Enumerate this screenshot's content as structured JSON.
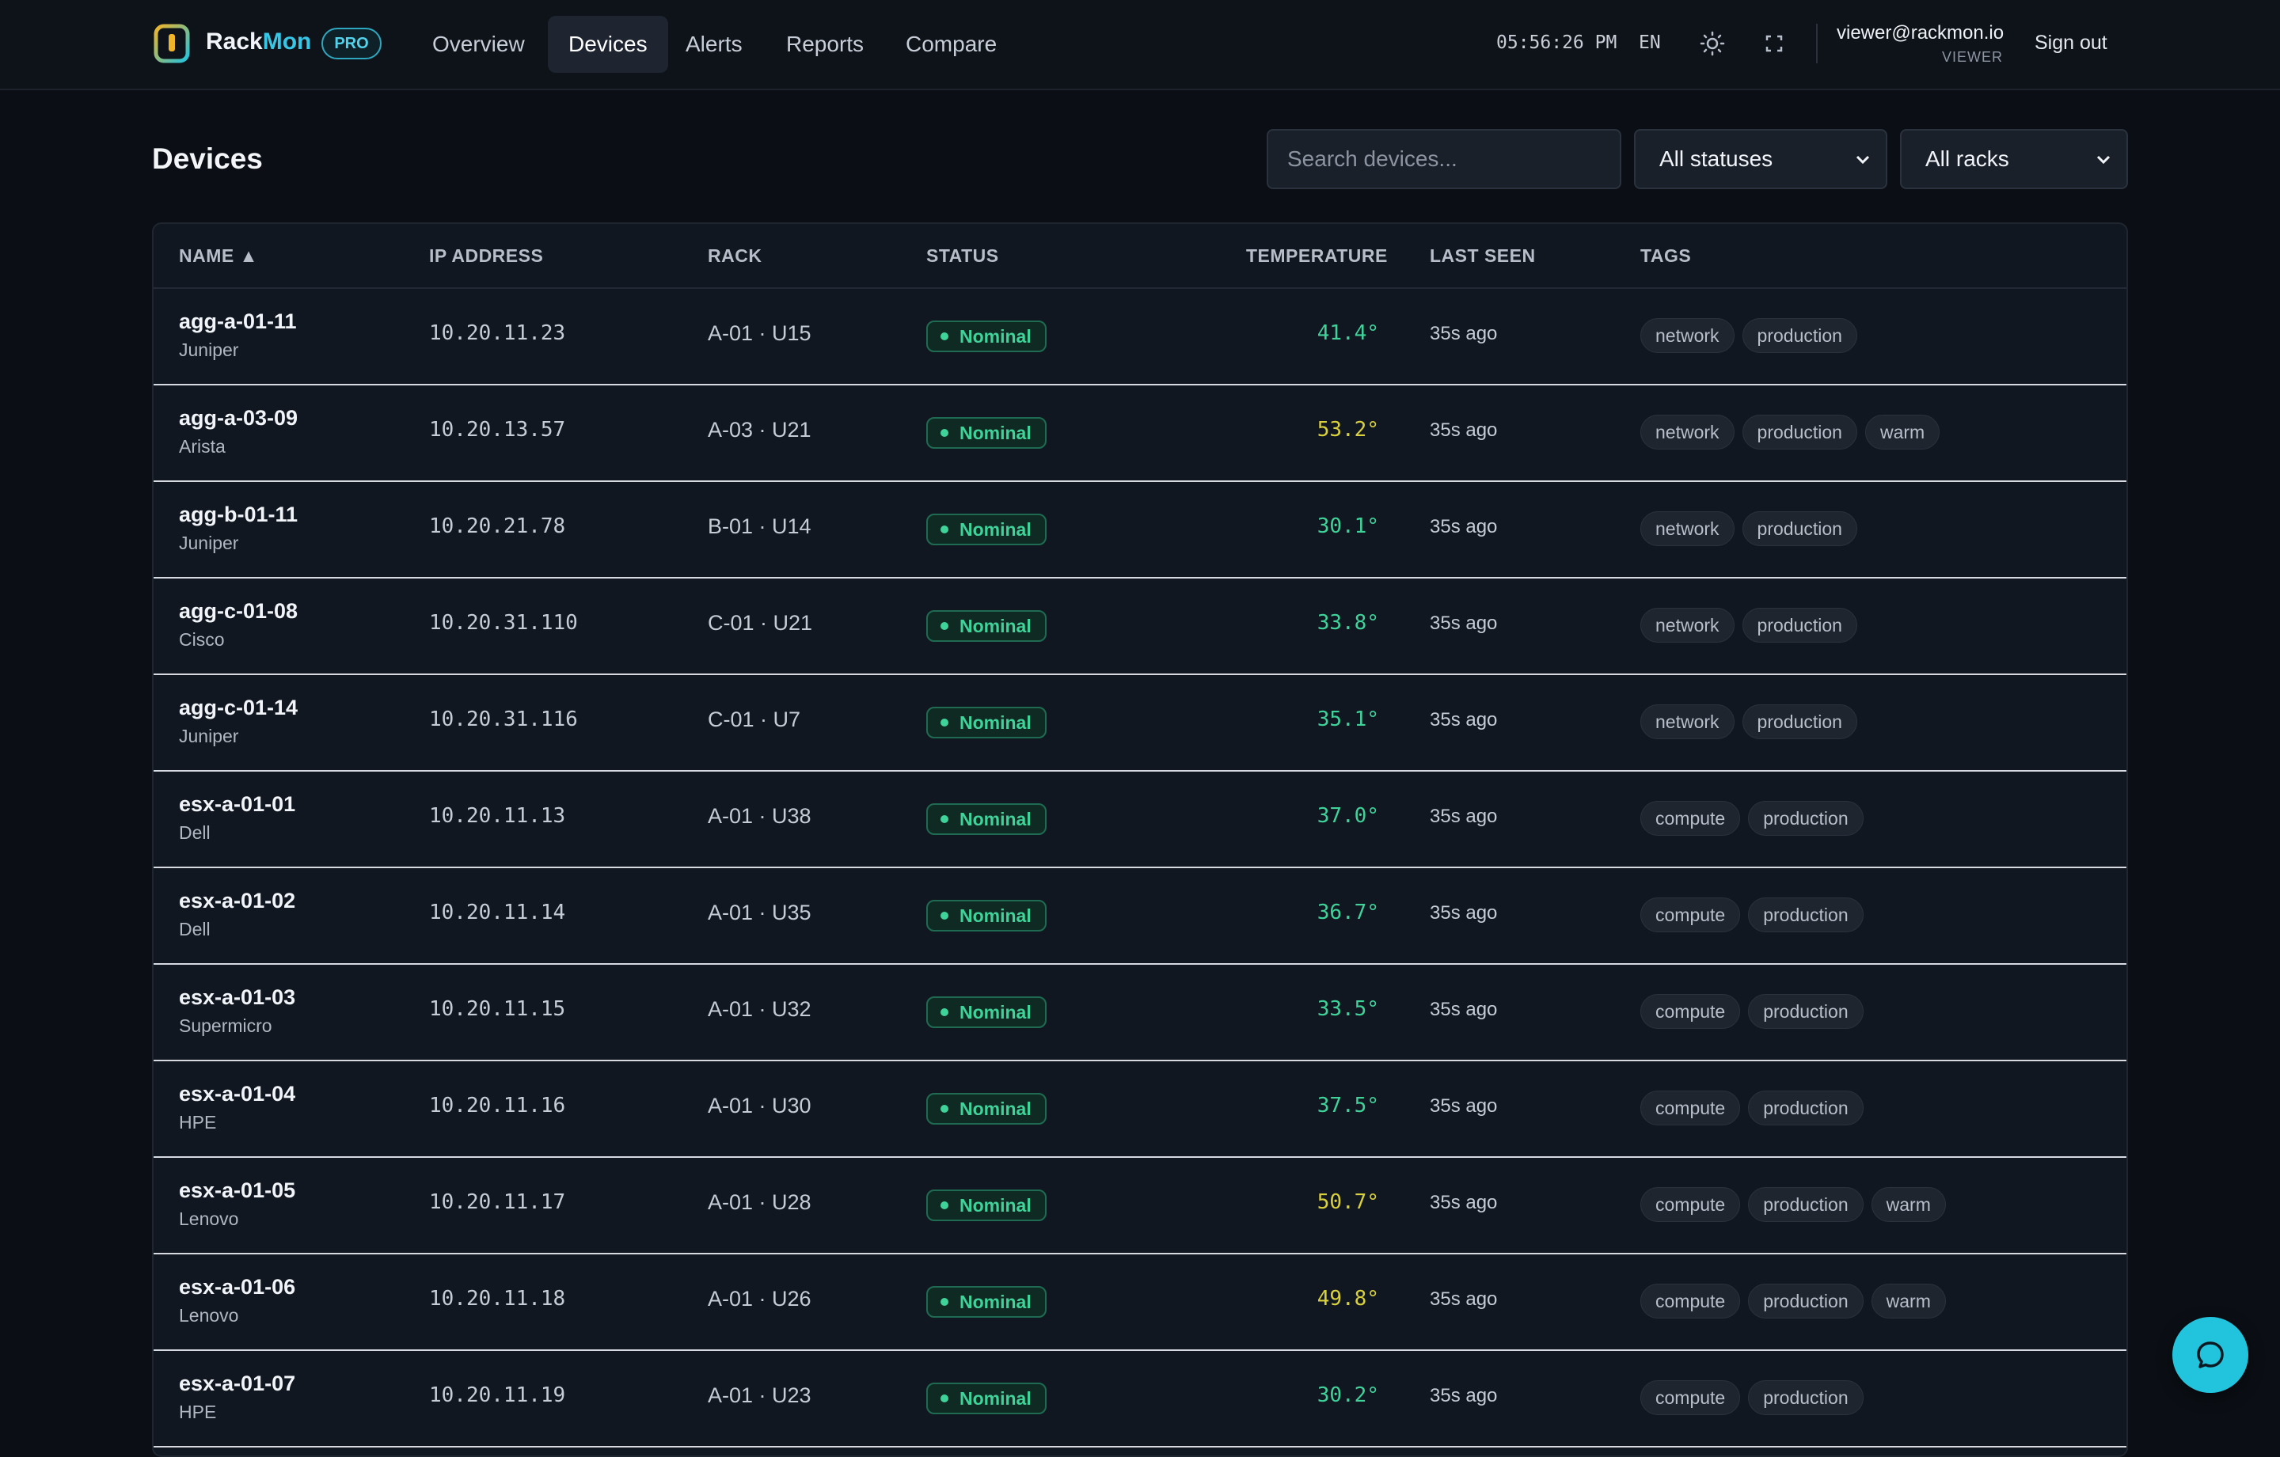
{
  "header": {
    "brand_part1": "Rack",
    "brand_part2": "Mon",
    "badge": "PRO",
    "nav": [
      {
        "label": "Overview"
      },
      {
        "label": "Devices",
        "active": true
      },
      {
        "label": "Alerts"
      },
      {
        "label": "Reports"
      },
      {
        "label": "Compare"
      }
    ],
    "clock": "05:56:26 PM",
    "lang": "EN",
    "theme_icon": "sun-icon",
    "fullscreen_icon": "fullscreen-icon",
    "user_email": "viewer@rackmon.io",
    "user_role": "VIEWER",
    "sign_out": "Sign out"
  },
  "page": {
    "title": "Devices",
    "search_placeholder": "Search devices...",
    "status_filter": "All statuses",
    "rack_filter": "All racks"
  },
  "table": {
    "columns": {
      "name": "NAME ▲",
      "ip": "IP ADDRESS",
      "rack": "RACK",
      "status": "STATUS",
      "temperature": "TEMPERATURE",
      "last_seen": "LAST SEEN",
      "tags": "TAGS"
    },
    "rows": [
      {
        "name": "agg-a-01-11",
        "vendor": "Juniper",
        "ip": "10.20.11.23",
        "rack": "A-01 · U15",
        "status": "Nominal",
        "temp": "41.4°",
        "temp_color": "#3fd39a",
        "seen": "35s ago",
        "tags": [
          "network",
          "production"
        ]
      },
      {
        "name": "agg-a-03-09",
        "vendor": "Arista",
        "ip": "10.20.13.57",
        "rack": "A-03 · U21",
        "status": "Nominal",
        "temp": "53.2°",
        "temp_color": "#d9d13b",
        "seen": "35s ago",
        "tags": [
          "network",
          "production",
          "warm"
        ]
      },
      {
        "name": "agg-b-01-11",
        "vendor": "Juniper",
        "ip": "10.20.21.78",
        "rack": "B-01 · U14",
        "status": "Nominal",
        "temp": "30.1°",
        "temp_color": "#3fd39a",
        "seen": "35s ago",
        "tags": [
          "network",
          "production"
        ]
      },
      {
        "name": "agg-c-01-08",
        "vendor": "Cisco",
        "ip": "10.20.31.110",
        "rack": "C-01 · U21",
        "status": "Nominal",
        "temp": "33.8°",
        "temp_color": "#3fd39a",
        "seen": "35s ago",
        "tags": [
          "network",
          "production"
        ]
      },
      {
        "name": "agg-c-01-14",
        "vendor": "Juniper",
        "ip": "10.20.31.116",
        "rack": "C-01 · U7",
        "status": "Nominal",
        "temp": "35.1°",
        "temp_color": "#3fd39a",
        "seen": "35s ago",
        "tags": [
          "network",
          "production"
        ]
      },
      {
        "name": "esx-a-01-01",
        "vendor": "Dell",
        "ip": "10.20.11.13",
        "rack": "A-01 · U38",
        "status": "Nominal",
        "temp": "37.0°",
        "temp_color": "#3fd39a",
        "seen": "35s ago",
        "tags": [
          "compute",
          "production"
        ]
      },
      {
        "name": "esx-a-01-02",
        "vendor": "Dell",
        "ip": "10.20.11.14",
        "rack": "A-01 · U35",
        "status": "Nominal",
        "temp": "36.7°",
        "temp_color": "#3fd39a",
        "seen": "35s ago",
        "tags": [
          "compute",
          "production"
        ]
      },
      {
        "name": "esx-a-01-03",
        "vendor": "Supermicro",
        "ip": "10.20.11.15",
        "rack": "A-01 · U32",
        "status": "Nominal",
        "temp": "33.5°",
        "temp_color": "#3fd39a",
        "seen": "35s ago",
        "tags": [
          "compute",
          "production"
        ]
      },
      {
        "name": "esx-a-01-04",
        "vendor": "HPE",
        "ip": "10.20.11.16",
        "rack": "A-01 · U30",
        "status": "Nominal",
        "temp": "37.5°",
        "temp_color": "#3fd39a",
        "seen": "35s ago",
        "tags": [
          "compute",
          "production"
        ]
      },
      {
        "name": "esx-a-01-05",
        "vendor": "Lenovo",
        "ip": "10.20.11.17",
        "rack": "A-01 · U28",
        "status": "Nominal",
        "temp": "50.7°",
        "temp_color": "#d9d13b",
        "seen": "35s ago",
        "tags": [
          "compute",
          "production",
          "warm"
        ]
      },
      {
        "name": "esx-a-01-06",
        "vendor": "Lenovo",
        "ip": "10.20.11.18",
        "rack": "A-01 · U26",
        "status": "Nominal",
        "temp": "49.8°",
        "temp_color": "#d9d13b",
        "seen": "35s ago",
        "tags": [
          "compute",
          "production",
          "warm"
        ]
      },
      {
        "name": "esx-a-01-07",
        "vendor": "HPE",
        "ip": "10.20.11.19",
        "rack": "A-01 · U23",
        "status": "Nominal",
        "temp": "30.2°",
        "temp_color": "#3fd39a",
        "seen": "35s ago",
        "tags": [
          "compute",
          "production"
        ]
      }
    ]
  },
  "chat_icon": "chat-bubble-icon"
}
